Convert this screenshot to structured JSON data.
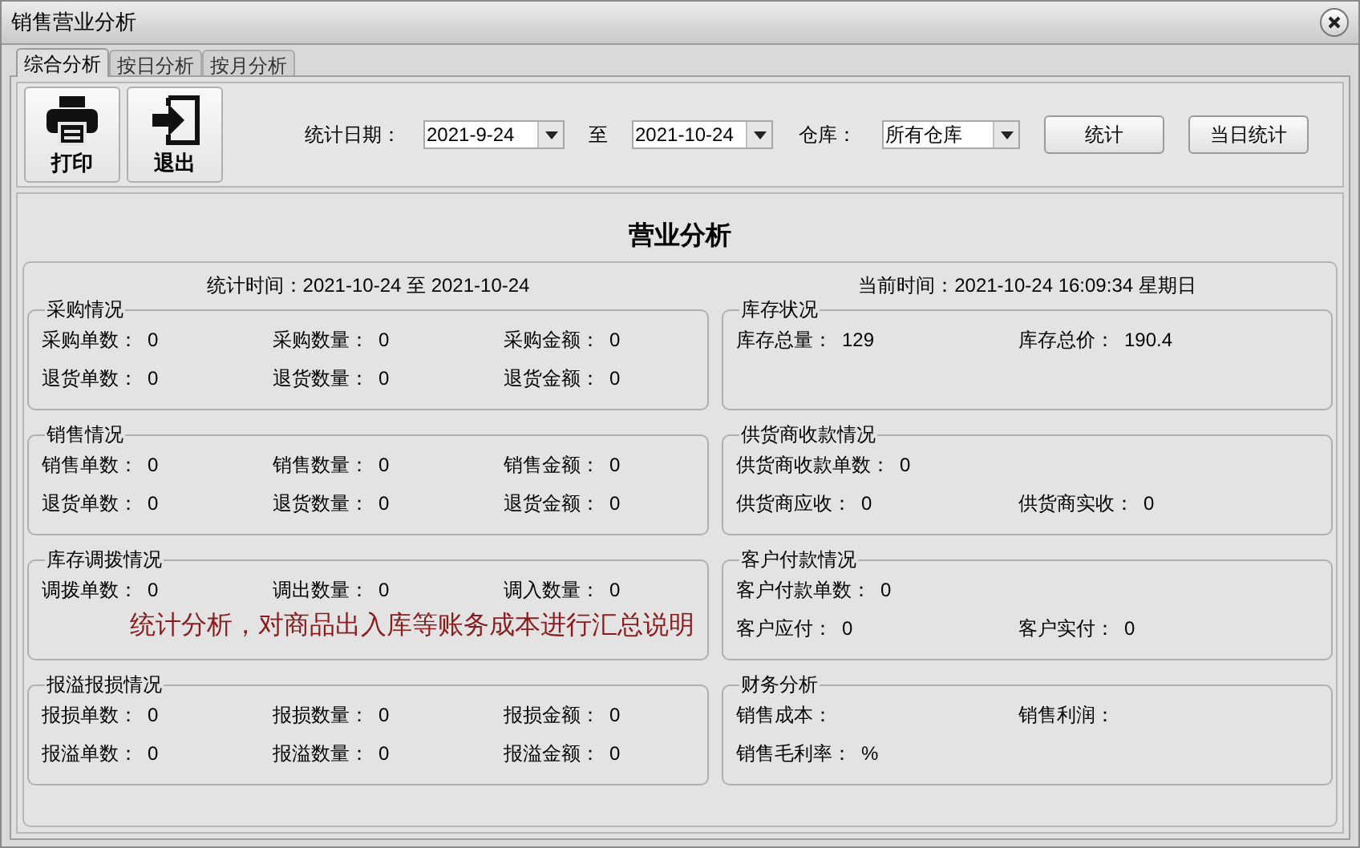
{
  "window": {
    "title": "销售营业分析"
  },
  "tabs": [
    {
      "label": "综合分析",
      "selected": true
    },
    {
      "label": "按日分析",
      "selected": false
    },
    {
      "label": "按月分析",
      "selected": false
    }
  ],
  "toolbar": {
    "buttons": [
      {
        "label": "打印",
        "kind": "print"
      },
      {
        "label": "退出",
        "kind": "exit"
      }
    ],
    "date_label": "统计日期：",
    "from_date": "2021-9-24",
    "to_label": "至",
    "to_date": "2021-10-24",
    "warehouse_label": "仓库：",
    "warehouse": "所有仓库",
    "actions": [
      "统计",
      "当日统计"
    ]
  },
  "report": {
    "title": "营业分析",
    "period": "统计时间：2021-10-24 至 2021-10-24",
    "current_time": "当前时间：2021-10-24 16:09:34 星期日",
    "left_groups": [
      {
        "title": "采购情况",
        "rows": [
          [
            {
              "label": "采购单数：",
              "value": "0"
            },
            {
              "label": "采购数量：",
              "value": "0"
            },
            {
              "label": "采购金额：",
              "value": "0"
            }
          ],
          [
            {
              "label": "退货单数：",
              "value": "0"
            },
            {
              "label": "退货数量：",
              "value": "0"
            },
            {
              "label": "退货金额：",
              "value": "0"
            }
          ]
        ]
      },
      {
        "title": "销售情况",
        "rows": [
          [
            {
              "label": "销售单数：",
              "value": "0"
            },
            {
              "label": "销售数量：",
              "value": "0"
            },
            {
              "label": "销售金额：",
              "value": "0"
            }
          ],
          [
            {
              "label": "退货单数：",
              "value": "0"
            },
            {
              "label": "退货数量：",
              "value": "0"
            },
            {
              "label": "退货金额：",
              "value": "0"
            }
          ]
        ]
      },
      {
        "title": "库存调拨情况",
        "rows": [
          [
            {
              "label": "调拨单数：",
              "value": "0"
            },
            {
              "label": "调出数量：",
              "value": "0"
            },
            {
              "label": "调入数量：",
              "value": "0"
            }
          ]
        ],
        "note": "统计分析，对商品出入库等账务成本进行汇总说明"
      },
      {
        "title": "报溢报损情况",
        "rows": [
          [
            {
              "label": "报损单数：",
              "value": "0"
            },
            {
              "label": "报损数量：",
              "value": "0"
            },
            {
              "label": "报损金额：",
              "value": "0"
            }
          ],
          [
            {
              "label": "报溢单数：",
              "value": "0"
            },
            {
              "label": "报溢数量：",
              "value": "0"
            },
            {
              "label": "报溢金额：",
              "value": "0"
            }
          ]
        ]
      }
    ],
    "right_groups": [
      {
        "title": "库存状况",
        "rows": [
          [
            {
              "label": "库存总量：",
              "value": "129"
            },
            {
              "label": "库存总价：",
              "value": "190.4"
            }
          ]
        ]
      },
      {
        "title": "供货商收款情况",
        "rows": [
          [
            {
              "label": "供货商收款单数：",
              "value": "0"
            }
          ],
          [
            {
              "label": "供货商应收：",
              "value": "0"
            },
            {
              "label": "供货商实收：",
              "value": "0"
            }
          ]
        ]
      },
      {
        "title": "客户付款情况",
        "rows": [
          [
            {
              "label": "客户付款单数：",
              "value": "0"
            }
          ],
          [
            {
              "label": "客户应付：",
              "value": "0"
            },
            {
              "label": "客户实付：",
              "value": "0"
            }
          ]
        ]
      },
      {
        "title": "财务分析",
        "rows": [
          [
            {
              "label": "销售成本："
            },
            {
              "label": "销售利润："
            }
          ],
          [
            {
              "label": "销售毛利率：",
              "value": "%"
            }
          ]
        ]
      }
    ]
  }
}
